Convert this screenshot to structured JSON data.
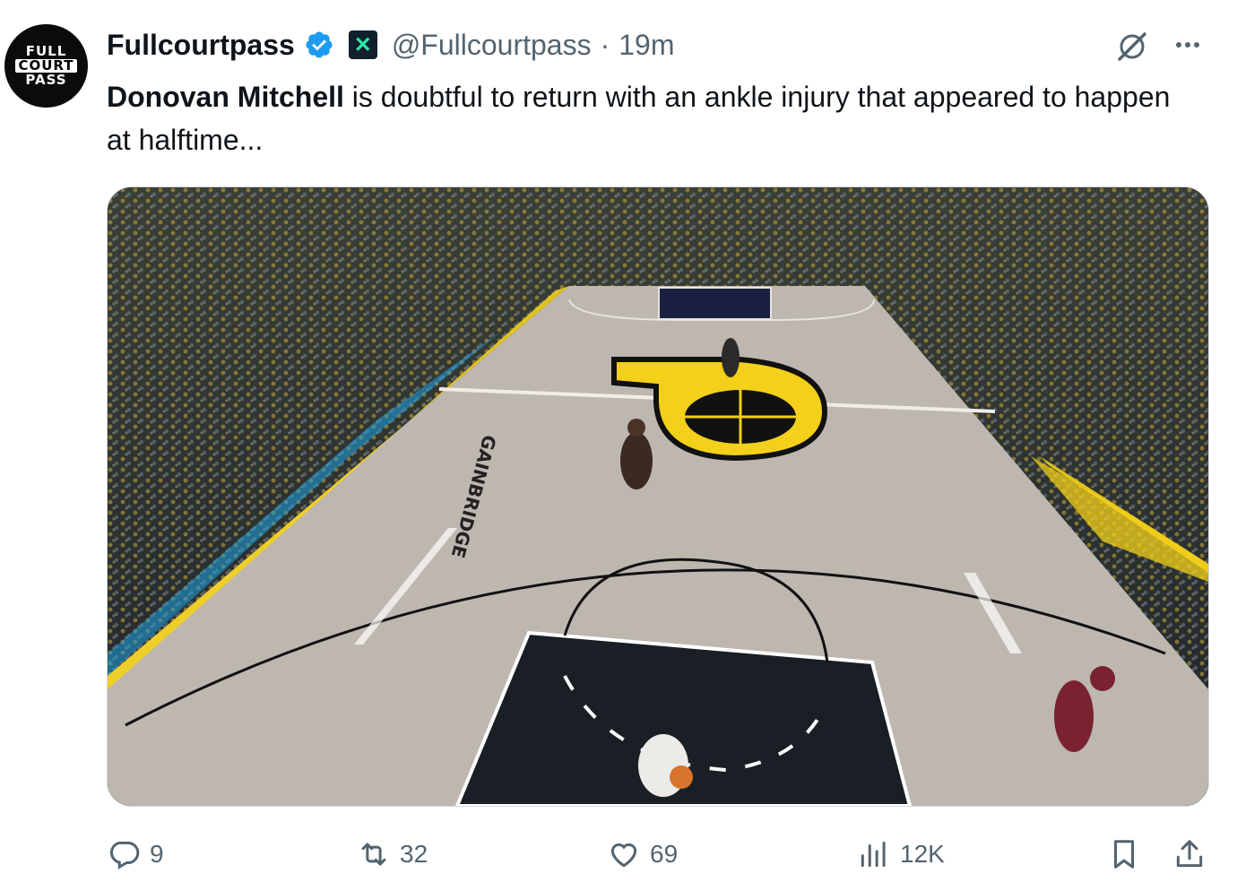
{
  "author": {
    "avatar_lines": [
      "FULL",
      "COURT",
      "PASS"
    ],
    "name": "Fullcourtpass",
    "handle": "@Fullcourtpass",
    "separator": "·",
    "time": "19m"
  },
  "tweet": {
    "bold_text": "Donovan Mitchell",
    "text": " is doubtful to return with an ankle injury that appeared to happen at halftime..."
  },
  "media": {
    "court_sponsor": "GAINBRIDGE"
  },
  "actions": {
    "replies": "9",
    "reposts": "32",
    "likes": "69",
    "views": "12K"
  },
  "colors": {
    "verified": "#1d9bf0",
    "muted": "#536471",
    "court_yellow": "#f3d01a",
    "court_blue": "#1ea0e0"
  }
}
